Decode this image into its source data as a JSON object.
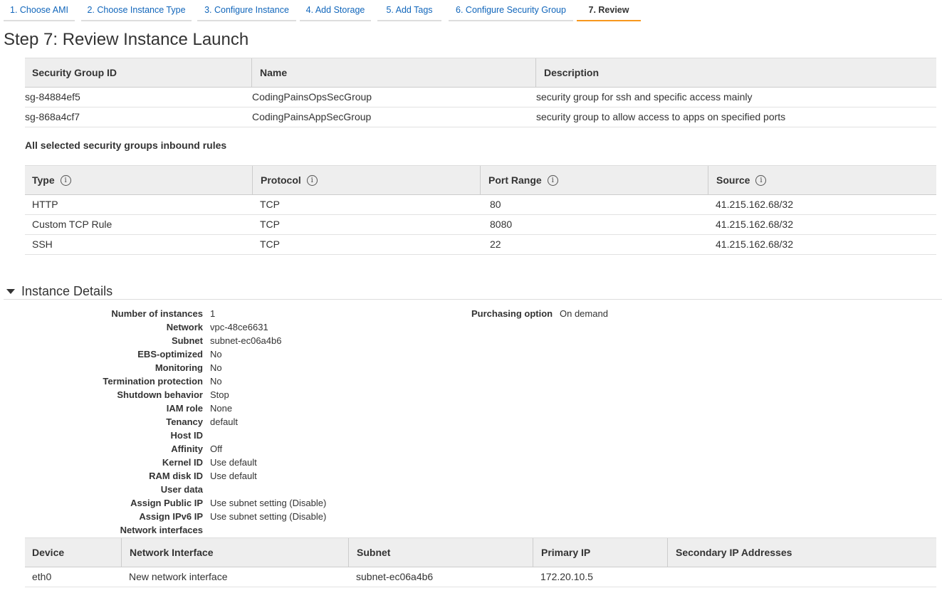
{
  "wizard": {
    "tabs": [
      {
        "label": "1. Choose AMI"
      },
      {
        "label": "2. Choose Instance Type"
      },
      {
        "label": "3. Configure Instance"
      },
      {
        "label": "4. Add Storage"
      },
      {
        "label": "5. Add Tags"
      },
      {
        "label": "6. Configure Security Group"
      },
      {
        "label": "7. Review"
      }
    ],
    "active_tab": "7. Review"
  },
  "page_title": "Step 7: Review Instance Launch",
  "security_groups": {
    "headers": [
      "Security Group ID",
      "Name",
      "Description"
    ],
    "rows": [
      [
        "sg-84884ef5",
        "CodingPainsOpsSecGroup",
        "security group for ssh and specific access mainly"
      ],
      [
        "sg-868a4cf7",
        "CodingPainsAppSecGroup",
        "security group to allow access to apps on specified ports"
      ]
    ]
  },
  "inbound": {
    "title": "All selected security groups inbound rules",
    "headers": [
      "Type",
      "Protocol",
      "Port Range",
      "Source"
    ],
    "info_icon": "i",
    "rows": [
      [
        "HTTP",
        "TCP",
        "80",
        "41.215.162.68/32"
      ],
      [
        "Custom TCP Rule",
        "TCP",
        "8080",
        "41.215.162.68/32"
      ],
      [
        "SSH",
        "TCP",
        "22",
        "41.215.162.68/32"
      ]
    ]
  },
  "instance_details": {
    "title": "Instance Details",
    "fields": [
      {
        "label": "Number of instances",
        "value": "1"
      },
      {
        "label": "Network",
        "value": "vpc-48ce6631"
      },
      {
        "label": "Subnet",
        "value": "subnet-ec06a4b6"
      },
      {
        "label": "EBS-optimized",
        "value": "No"
      },
      {
        "label": "Monitoring",
        "value": "No"
      },
      {
        "label": "Termination protection",
        "value": "No"
      },
      {
        "label": "Shutdown behavior",
        "value": "Stop"
      },
      {
        "label": "IAM role",
        "value": "None"
      },
      {
        "label": "Tenancy",
        "value": "default"
      },
      {
        "label": "Host ID",
        "value": ""
      },
      {
        "label": "Affinity",
        "value": "Off"
      },
      {
        "label": "Kernel ID",
        "value": "Use default"
      },
      {
        "label": "RAM disk ID",
        "value": "Use default"
      },
      {
        "label": "User data",
        "value": ""
      },
      {
        "label": "Assign Public IP",
        "value": "Use subnet setting (Disable)"
      },
      {
        "label": "Assign IPv6 IP",
        "value": "Use subnet setting (Disable)"
      },
      {
        "label": "Network interfaces",
        "value": ""
      }
    ],
    "purchasing_option": {
      "label": "Purchasing option",
      "value": "On demand"
    }
  },
  "network_interfaces": {
    "headers": [
      "Device",
      "Network Interface",
      "Subnet",
      "Primary IP",
      "Secondary IP Addresses"
    ],
    "rows": [
      [
        "eth0",
        "New network interface",
        "subnet-ec06a4b6",
        "172.20.10.5",
        ""
      ]
    ]
  }
}
